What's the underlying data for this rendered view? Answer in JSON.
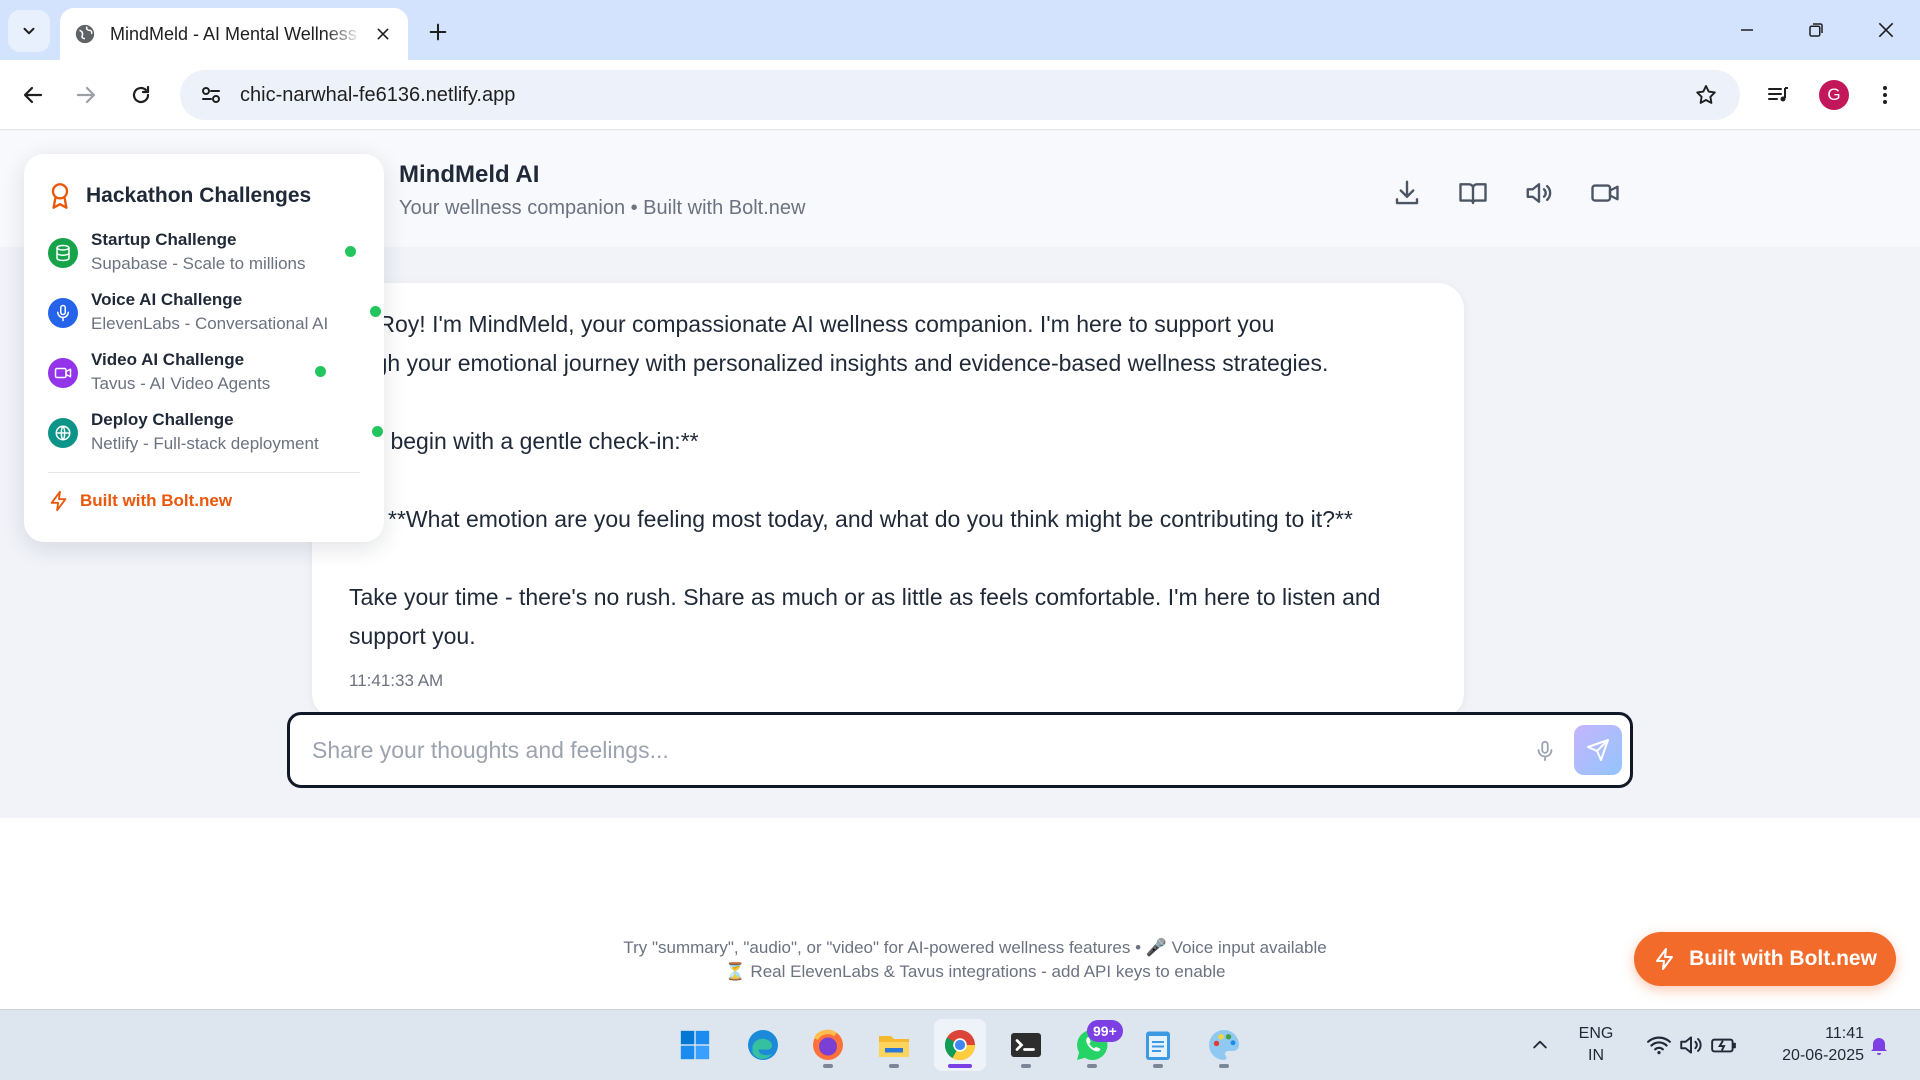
{
  "browser": {
    "tab_title": "MindMeld - AI Mental Wellness",
    "url": "chic-narwhal-fe6136.netlify.app",
    "profile_initial": "G"
  },
  "app": {
    "title": "MindMeld AI",
    "subtitle": "Your wellness companion • Built with Bolt.new",
    "header_actions": [
      "download-icon",
      "book-icon",
      "speaker-icon",
      "video-camera-icon"
    ]
  },
  "hackathon": {
    "title": "Hackathon Challenges",
    "items": [
      {
        "name": "Startup Challenge",
        "desc": "Supabase - Scale to millions",
        "icon": "database-icon",
        "color": "#16a34a"
      },
      {
        "name": "Voice AI Challenge",
        "desc": "ElevenLabs - Conversational AI",
        "icon": "microphone-icon",
        "color": "#2563eb"
      },
      {
        "name": "Video AI Challenge",
        "desc": "Tavus - AI Video Agents",
        "icon": "video-icon",
        "color": "#9333ea"
      },
      {
        "name": "Deploy Challenge",
        "desc": "Netlify - Full-stack deployment",
        "icon": "globe-icon",
        "color": "#0d9488"
      }
    ],
    "footer": "Built with Bolt.new"
  },
  "message": {
    "lines": [
      "llo Roy! I'm MindMeld, your compassionate AI wellness companion. I'm here to support you",
      "ough your emotional journey with personalized insights and evidence-based wellness strategies.",
      "et's begin with a gentle check-in:**",
      "**What emotion are you feeling most today, and what do you think might be contributing to it?**",
      "Take your time - there's no rush. Share as much or as little as feels comfortable. I'm here to listen and",
      "support you."
    ],
    "time": "11:41:33 AM"
  },
  "composer": {
    "placeholder": "Share your thoughts and feelings...",
    "value": ""
  },
  "hints": {
    "line1": "Try \"summary\", \"audio\", or \"video\" for AI-powered wellness features • 🎤 Voice input available",
    "line2": "⏳ Real ElevenLabs & Tavus integrations - add API keys to enable"
  },
  "cta": {
    "label": "Built with Bolt.new"
  },
  "colors": {
    "accent": "#f26b2a",
    "online": "#22c55e"
  },
  "taskbar": {
    "apps": [
      "windows-start-icon",
      "edge-icon",
      "firefox-icon",
      "file-explorer-icon",
      "chrome-icon",
      "terminal-icon",
      "whatsapp-icon",
      "notepad-icon",
      "paint-icon"
    ],
    "whatsapp_badge": "99+",
    "lang_line1": "ENG",
    "lang_line2": "IN",
    "time": "11:41",
    "date": "20-06-2025"
  }
}
